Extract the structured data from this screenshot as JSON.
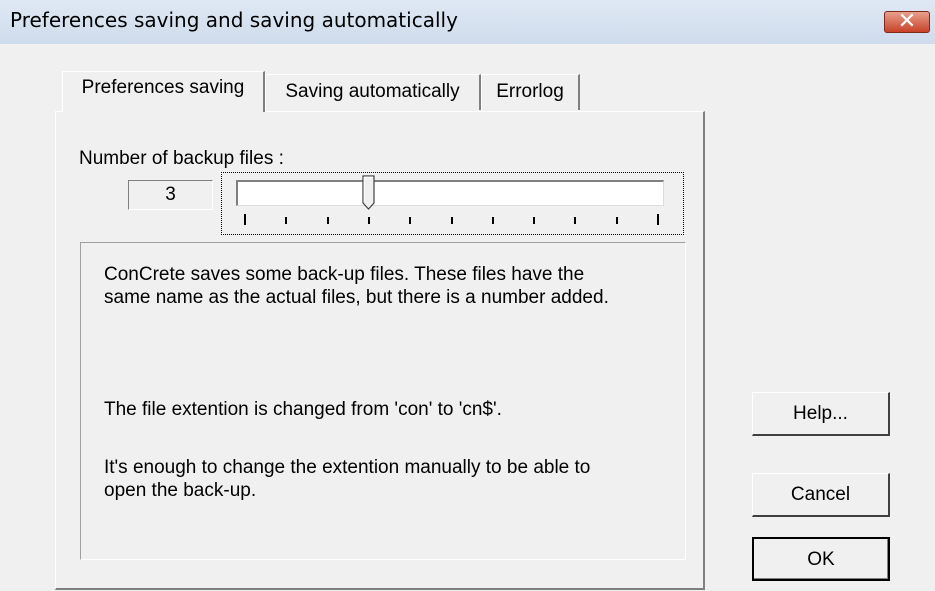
{
  "window": {
    "title": "Preferences saving and saving automatically",
    "close_glyph": "✕"
  },
  "tabs": [
    {
      "label": "Preferences saving",
      "active": true
    },
    {
      "label": "Saving automatically",
      "active": false
    },
    {
      "label": "Errorlog",
      "active": false
    }
  ],
  "backup": {
    "label": "Number of backup files :",
    "value": "3",
    "slider": {
      "min": 0,
      "max": 10,
      "value": 3,
      "tick_count": 11
    }
  },
  "info": {
    "paragraph1": "ConCrete saves some back-up files. These files have the\nsame name as the actual files, but there is a number added.",
    "paragraph2": "The file extention is changed from 'con' to 'cn$'.",
    "paragraph3": "It's enough to change the extention manually to be able to\nopen the back-up."
  },
  "buttons": {
    "help": "Help...",
    "cancel": "Cancel",
    "ok": "OK"
  },
  "colors": {
    "title_bar": "#d6e1ef",
    "dialog_bg": "#f0f0f0",
    "close_button": "#c7432a"
  }
}
